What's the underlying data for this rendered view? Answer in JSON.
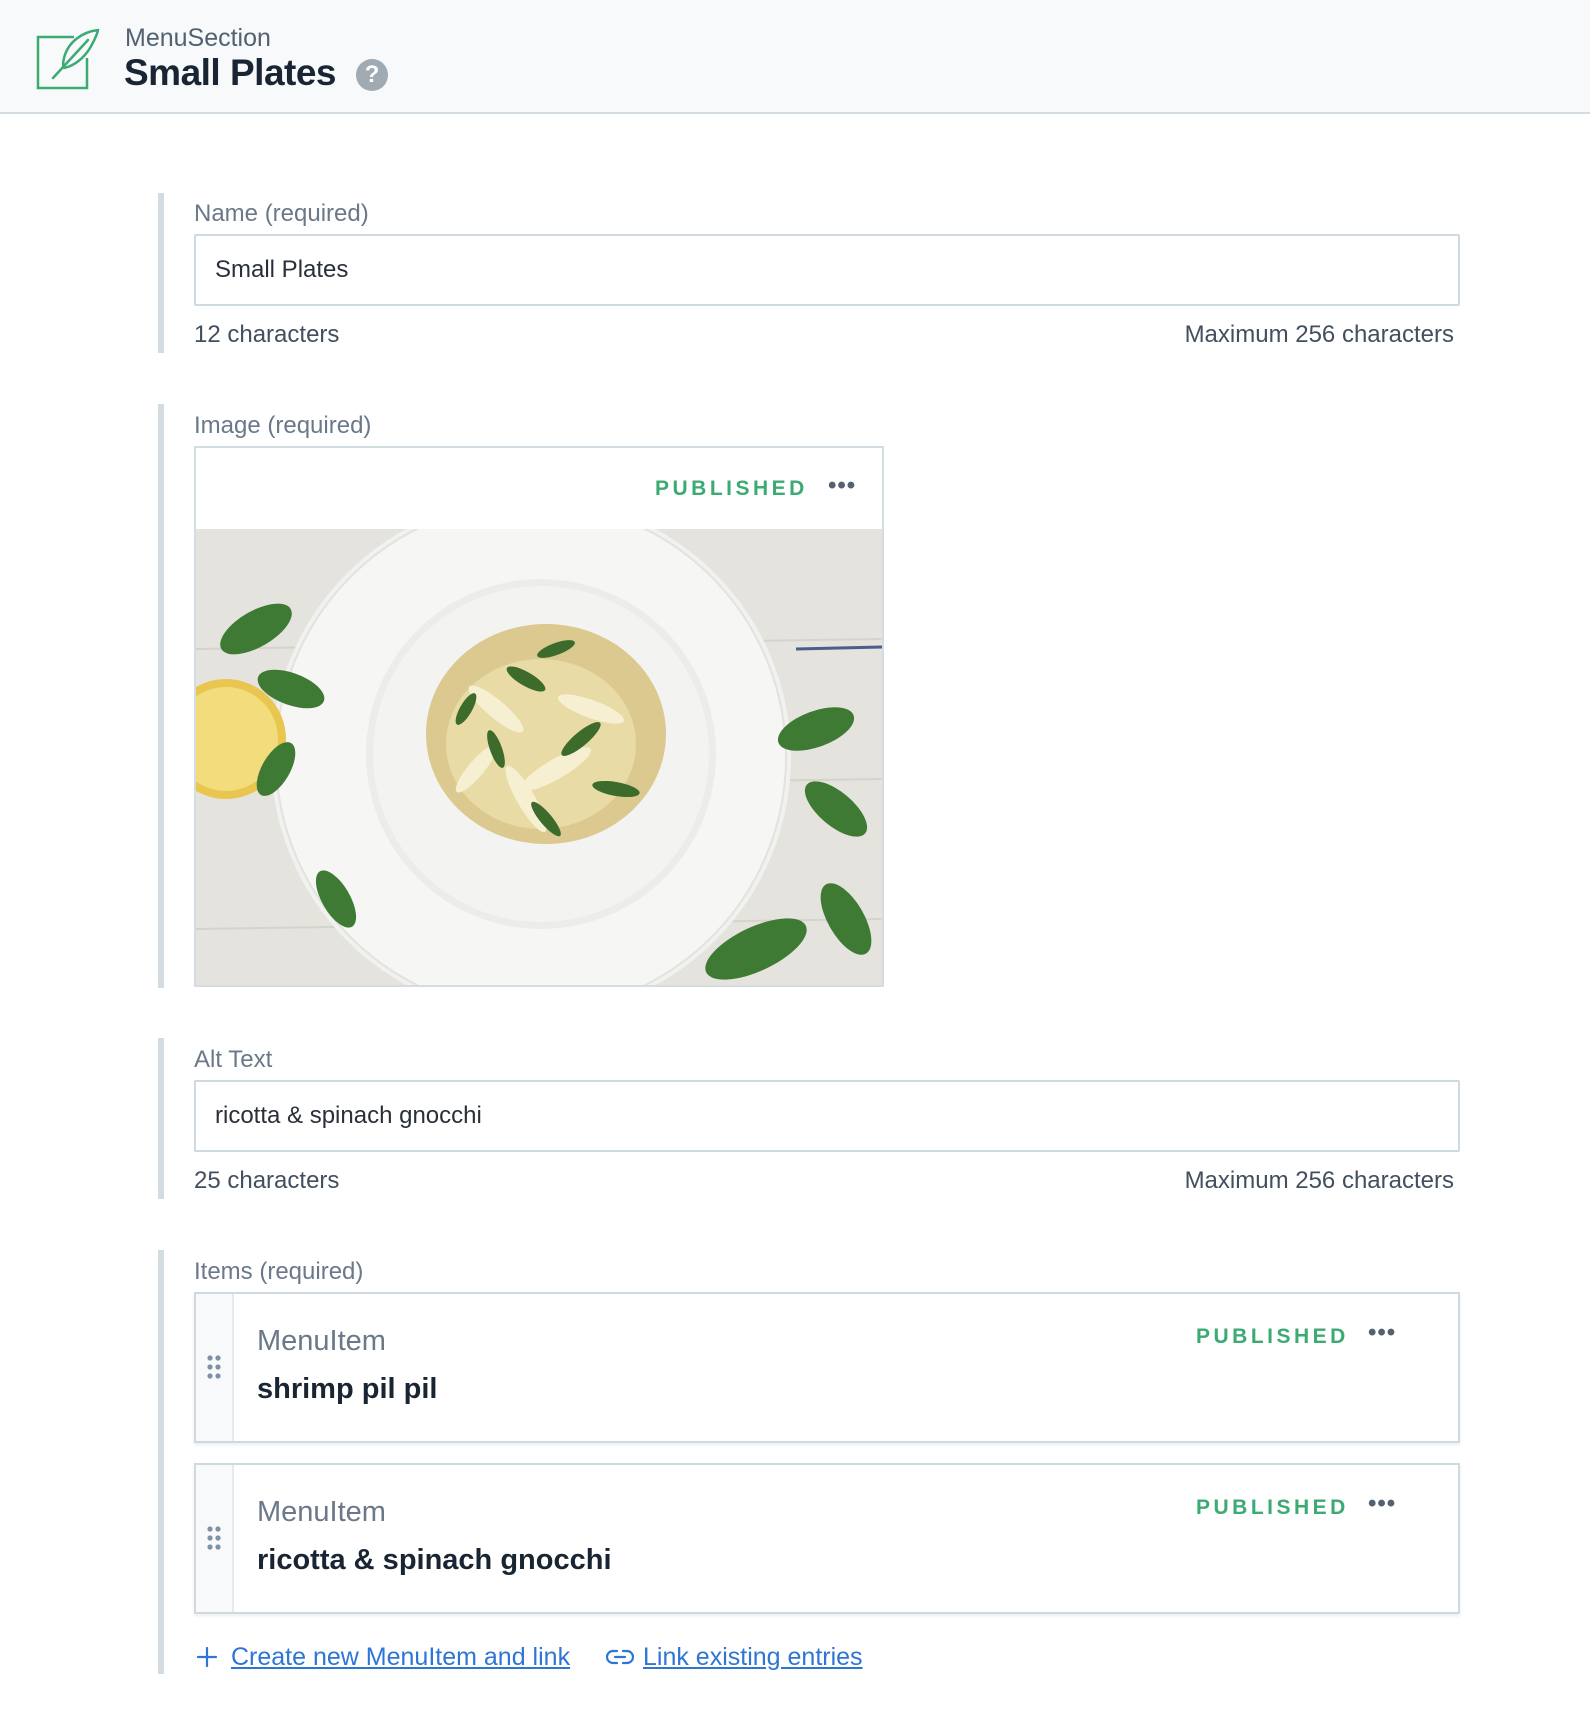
{
  "header": {
    "content_type": "MenuSection",
    "title": "Small Plates",
    "help_icon": "?",
    "icon_name": "feather-pen-icon"
  },
  "fields": {
    "name": {
      "label": "Name (required)",
      "value": "Small Plates",
      "count": "12 characters",
      "max": "Maximum 256 characters"
    },
    "image": {
      "label": "Image (required)",
      "status": "PUBLISHED",
      "menu": "•••",
      "image_description_icon": "pasta-dish-photo"
    },
    "alt_text": {
      "label": "Alt Text",
      "value": "ricotta & spinach gnocchi",
      "count": "25 characters",
      "max": "Maximum 256 characters"
    },
    "items": {
      "label": "Items (required)",
      "entries": [
        {
          "type": "MenuItem",
          "title": "shrimp pil pil",
          "status": "PUBLISHED",
          "menu": "•••"
        },
        {
          "type": "MenuItem",
          "title": "ricotta & spinach gnocchi",
          "status": "PUBLISHED",
          "menu": "•••"
        }
      ],
      "create_link": "Create new MenuItem and link",
      "link_existing": "Link existing entries"
    }
  },
  "colors": {
    "published": "#3caa73",
    "link": "#2e75d4",
    "field_border": "#d3dce0",
    "header_bg": "#f7f9fa"
  }
}
